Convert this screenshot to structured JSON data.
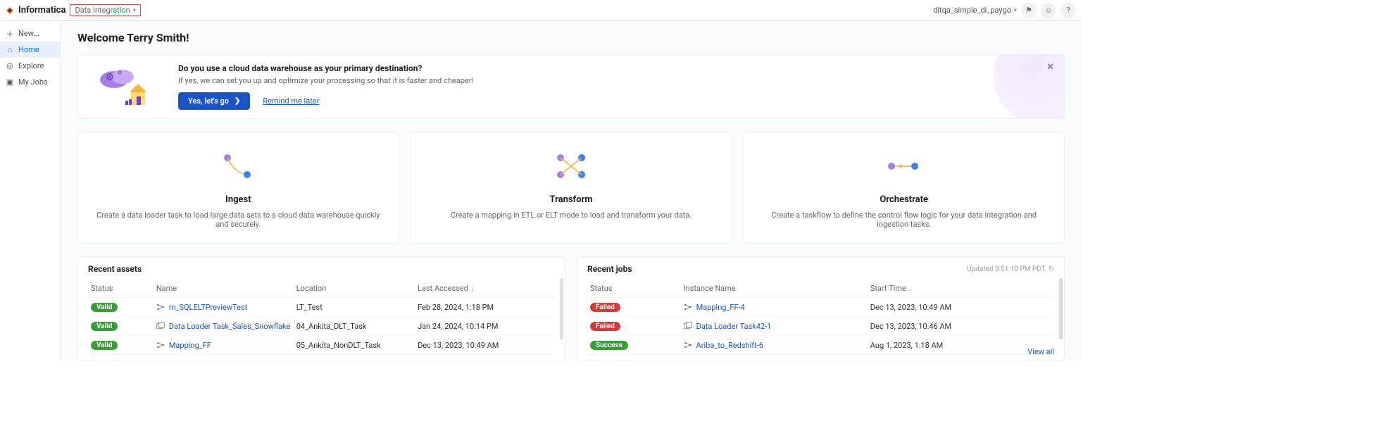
{
  "topbar": {
    "brand": "Informatica",
    "product": "Data Integration",
    "org": "ditqa_simple_di_paygo"
  },
  "sidebar": {
    "new": "New...",
    "items": [
      {
        "label": "Home"
      },
      {
        "label": "Explore"
      },
      {
        "label": "My Jobs"
      }
    ]
  },
  "welcome": "Welcome Terry Smith!",
  "promo": {
    "title": "Do you use a cloud data warehouse as your primary destination?",
    "sub": "If yes, we can set you up and optimize your processing so that it is faster and cheaper!",
    "cta": "Yes, let's go",
    "remind": "Remind me later"
  },
  "cards": [
    {
      "title": "Ingest",
      "desc": "Create a data loader task to load large data sets to a cloud data warehouse quickly and securely."
    },
    {
      "title": "Transform",
      "desc": "Create a mapping in ETL or ELT mode to load and transform your data."
    },
    {
      "title": "Orchestrate",
      "desc": "Create a taskflow to define the control flow logic for your data integration and ingestion tasks."
    }
  ],
  "recent_assets": {
    "title": "Recent assets",
    "cols": {
      "status": "Status",
      "name": "Name",
      "location": "Location",
      "last_accessed": "Last Accessed"
    },
    "rows": [
      {
        "status": "Valid",
        "name": "m_SQLELTPreviewTest",
        "location": "LT_Test",
        "last": "Feb 28, 2024, 1:18 PM",
        "icon": "mapping"
      },
      {
        "status": "Valid",
        "name": "Data Loader Task_Sales_Snowflake",
        "location": "04_Ankita_DLT_Task",
        "last": "Jan 24, 2024, 10:14 PM",
        "icon": "loader"
      },
      {
        "status": "Valid",
        "name": "Mapping_FF",
        "location": "05_Ankita_NonDLT_Task",
        "last": "Dec 13, 2023, 10:49 AM",
        "icon": "mapping"
      }
    ]
  },
  "recent_jobs": {
    "title": "Recent jobs",
    "updated": "Updated 3:51:10 PM PDT",
    "cols": {
      "status": "Status",
      "instance": "Instance Name",
      "start": "Start Time"
    },
    "rows": [
      {
        "status": "Failed",
        "name": "Mapping_FF-4",
        "start": "Dec 13, 2023, 10:49 AM",
        "icon": "mapping"
      },
      {
        "status": "Failed",
        "name": "Data Loader Task42-1",
        "start": "Dec 13, 2023, 10:46 AM",
        "icon": "loader"
      },
      {
        "status": "Success",
        "name": "Ariba_to_Redshift-6",
        "start": "Aug 1, 2023, 1:18 AM",
        "icon": "mapping"
      }
    ],
    "view_all": "View all"
  }
}
